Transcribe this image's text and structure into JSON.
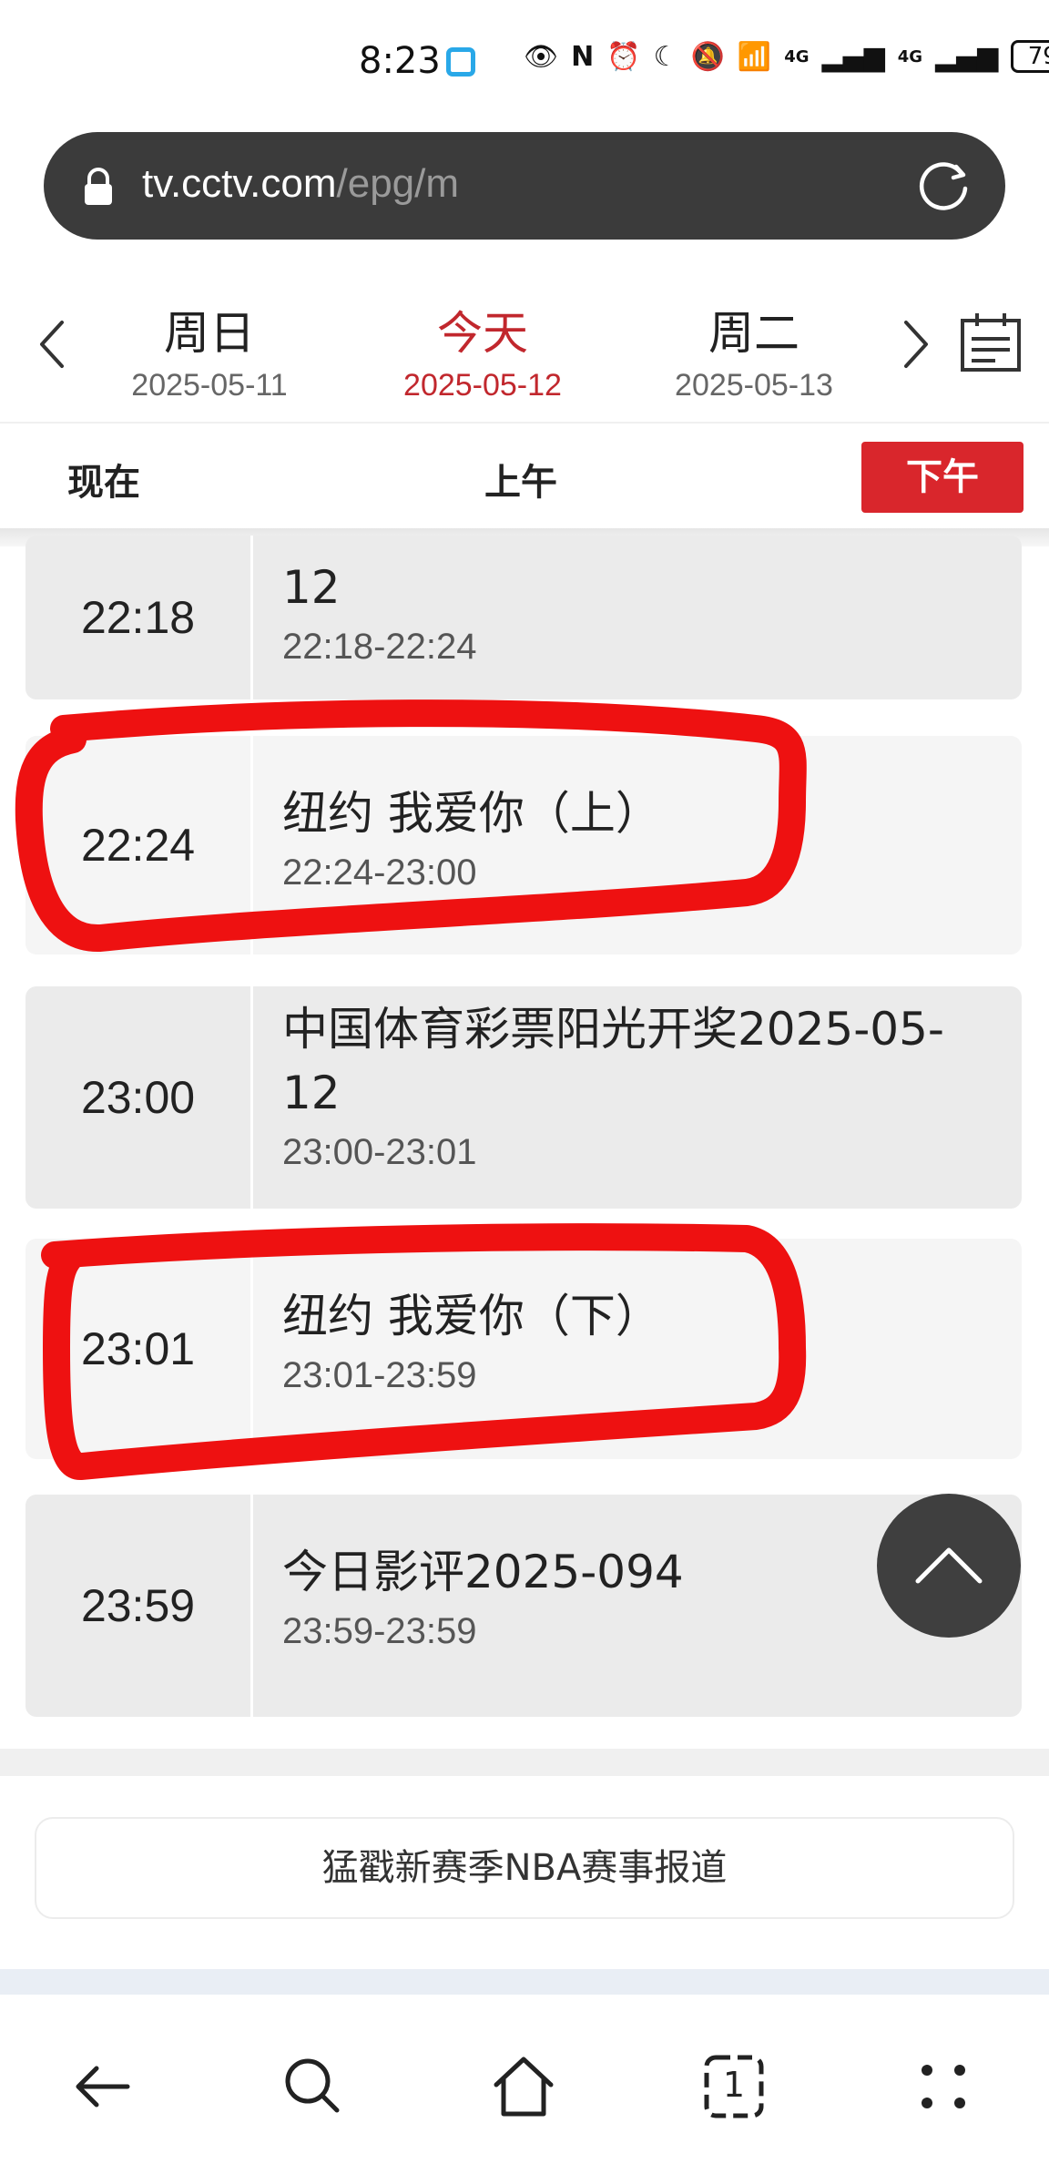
{
  "status_bar": {
    "time": "8:23",
    "network_1": "4G",
    "network_2": "4G",
    "battery": "79"
  },
  "browser": {
    "url_host": "tv.cctv.com",
    "url_path": "/epg/m"
  },
  "date_nav": {
    "days": [
      {
        "name": "周日",
        "date": "2025-05-11"
      },
      {
        "name": "今天",
        "date": "2025-05-12"
      },
      {
        "name": "周二",
        "date": "2025-05-13"
      }
    ]
  },
  "period_tabs": {
    "now": "现在",
    "am": "上午",
    "pm": "下午"
  },
  "programs": [
    {
      "time": "22:18",
      "title": "12",
      "range": "22:18-22:24"
    },
    {
      "time": "22:24",
      "title": "纽约 我爱你（上）",
      "range": "22:24-23:00"
    },
    {
      "time": "23:00",
      "title": "中国体育彩票阳光开奖2025-05-12",
      "range": "23:00-23:01"
    },
    {
      "time": "23:01",
      "title": "纽约 我爱你（下）",
      "range": "23:01-23:59"
    },
    {
      "time": "23:59",
      "title": "今日影评2025-094",
      "range": "23:59-23:59"
    }
  ],
  "promo": {
    "label": "猛戳新赛季NBA赛事报道"
  },
  "bottom_nav": {
    "tab_count": "1"
  },
  "colors": {
    "accent": "#d9262c",
    "annotation": "#ee1111"
  }
}
